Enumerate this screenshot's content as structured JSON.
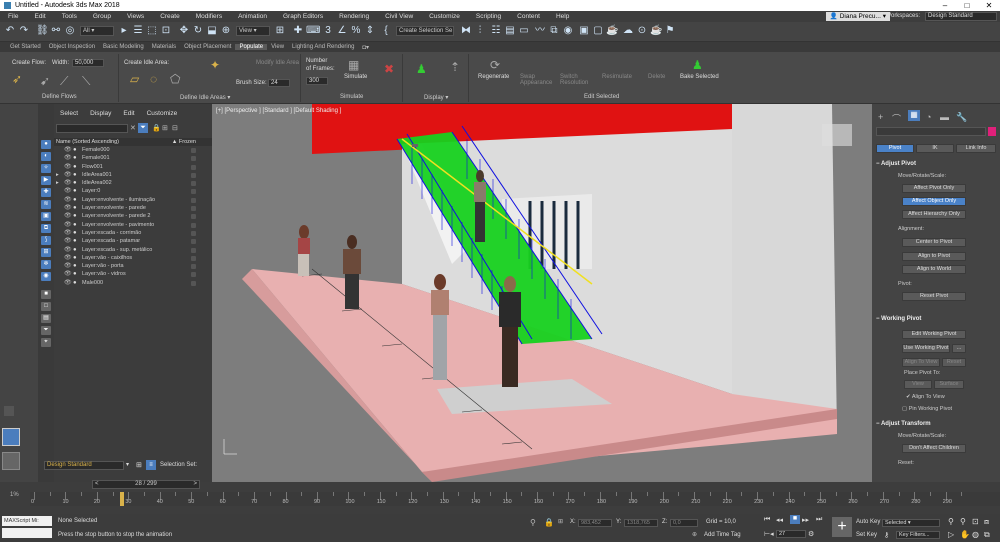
{
  "window": {
    "title": "Untitled - Autodesk 3ds Max 2018"
  },
  "menu": [
    "File",
    "Edit",
    "Tools",
    "Group",
    "Views",
    "Create",
    "Modifiers",
    "Animation",
    "Graph Editors",
    "Rendering",
    "Civil View",
    "Customize",
    "Scripting",
    "Content",
    "Help"
  ],
  "user": {
    "name": "Diana Precu...",
    "workspace_label": "Workspaces:",
    "workspace": "Design Standard"
  },
  "toolbar": {
    "filter": "All",
    "view": "View",
    "selection_set": "Create Selection Se"
  },
  "ribbon_tabs": [
    "Get Started",
    "Object Inspection",
    "Basic Modeling",
    "Materials",
    "Object Placement",
    "Populate",
    "View",
    "Lighting And Rendering"
  ],
  "ribbon_active": "Populate",
  "ribbon": {
    "create_flow": "Create Flow:",
    "width_label": "Width:",
    "width_value": "50,000",
    "create_idle": "Create Idle Area:",
    "modify_idle": "Modify Idle Area",
    "brush_label": "Brush Size:",
    "brush_value": "24",
    "number_label": "Number",
    "frames_label": "of Frames:",
    "frames_value": "300",
    "simulate": "Simulate",
    "regenerate": "Regenerate",
    "swap": "Swap Appearance",
    "switch": "Switch Resolution",
    "resimulate": "Resimulate",
    "delete": "Delete",
    "bake": "Bake Selected",
    "groups": [
      "Define Flows",
      "Define Idle Areas",
      "Simulate",
      "Display",
      "Edit Selected"
    ]
  },
  "scene_explorer": {
    "menu": [
      "Select",
      "Display",
      "Edit",
      "Customize"
    ],
    "col_name": "Name (Sorted Ascending)",
    "col_frozen": "▲ Frozen",
    "rows": [
      "Female000",
      "Female001",
      "Flow001",
      "IdleArea001",
      "IdleArea002",
      "Layer:0",
      "Layer:envolvente - iluminação",
      "Layer:envolvente - parede",
      "Layer:envolvente - parede 2",
      "Layer:envolvente - pavimento",
      "Layer:escada - corrimão",
      "Layer:escada - patamar",
      "Layer:escada - sup. metálico",
      "Layer:vão - caixilhos",
      "Layer:vão - porta",
      "Layer:vão - vidros",
      "Male000"
    ],
    "footer_set": "Design Standard",
    "selection_set_label": "Selection Set:"
  },
  "viewport": {
    "label": "[+] [Perspective ] [Standard ] [Default Shading ]"
  },
  "command_panel": {
    "tabs": [
      "Pivot",
      "IK",
      "Link Info"
    ],
    "adjust_pivot": "Adjust Pivot",
    "move_rotate_scale": "Move/Rotate/Scale:",
    "affect_pivot": "Affect Pivot Only",
    "affect_object": "Affect Object Only",
    "affect_hierarchy": "Affect Hierarchy Only",
    "alignment": "Alignment:",
    "center_to_pivot": "Center to Pivot",
    "align_to_pivot": "Align to Pivot",
    "align_to_world": "Align to World",
    "pivot_label": "Pivot:",
    "reset_pivot": "Reset Pivot",
    "working_pivot": "Working Pivot",
    "edit_working_pivot": "Edit Working Pivot",
    "use_working_pivot": "Use Working Pivot",
    "align_to_view": "Align To View",
    "reset": "Reset",
    "place_pivot_to": "Place Pivot To:",
    "view": "View",
    "surface": "Surface",
    "align_to_view_check": "Align To View",
    "pin_working_pivot": "Pin Working Pivot",
    "adjust_transform": "Adjust Transform",
    "move_rotate_scale2": "Move/Rotate/Scale:",
    "dont_affect_children": "Don't Affect Children",
    "reset_label": "Reset:"
  },
  "timeline": {
    "frame": "28 / 299",
    "ticks": [
      "0",
      "10",
      "20",
      "30",
      "40",
      "50",
      "60",
      "70",
      "80",
      "90",
      "100",
      "110",
      "120",
      "130",
      "140",
      "150",
      "160",
      "170",
      "180",
      "190",
      "200",
      "210",
      "220",
      "230",
      "240",
      "250",
      "260",
      "270",
      "280",
      "290"
    ]
  },
  "status": {
    "maxscript": "MAXScript Mi:",
    "selected": "None Selected",
    "prompt": "Press the stop button to stop the animation",
    "x_label": "X:",
    "x_value": "983,452",
    "y_label": "Y:",
    "y_value": "1318,765",
    "z_label": "Z:",
    "z_value": "0,0",
    "grid": "Grid = 10,0",
    "add_time_tag": "Add Time Tag",
    "frame_box": "27",
    "auto_key": "Auto Key",
    "selected_dd": "Selected",
    "set_key": "Set Key",
    "key_filters": "Key Filters..."
  },
  "percent": "1%"
}
